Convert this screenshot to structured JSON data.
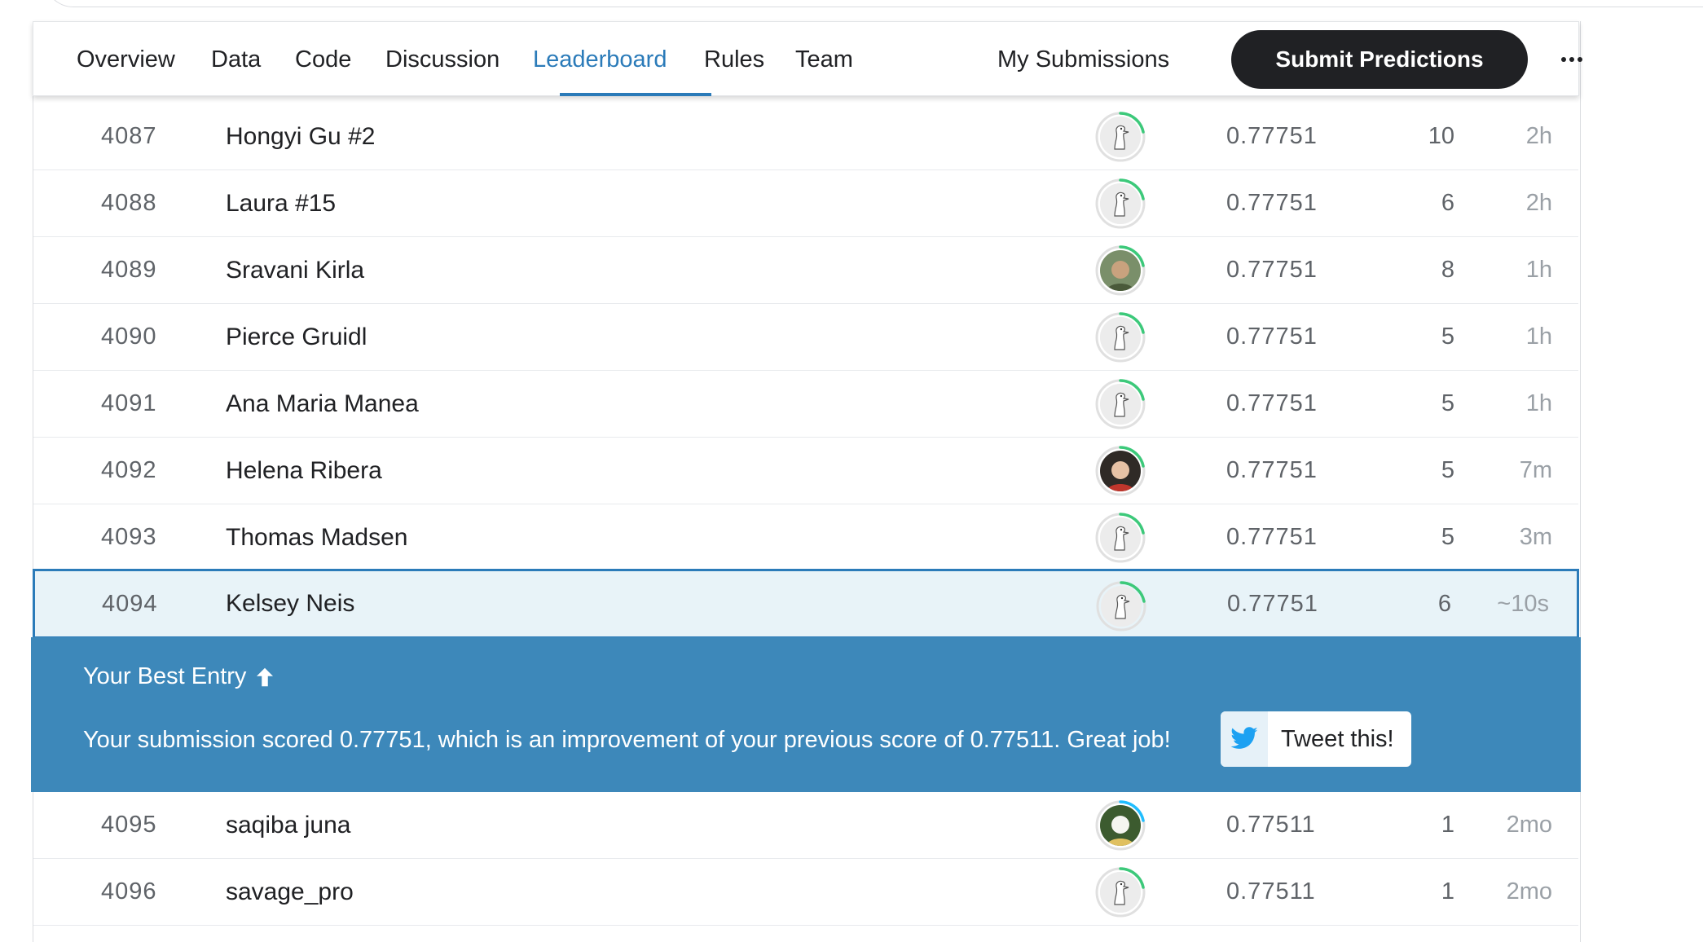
{
  "nav": {
    "tabs": [
      {
        "label": "Overview"
      },
      {
        "label": "Data"
      },
      {
        "label": "Code"
      },
      {
        "label": "Discussion"
      },
      {
        "label": "Leaderboard",
        "active": true
      },
      {
        "label": "Rules"
      },
      {
        "label": "Team"
      }
    ],
    "my_submissions": "My Submissions",
    "submit_label": "Submit Predictions",
    "more_icon": "more-horizontal-icon"
  },
  "rows_before": [
    {
      "rank": "4087",
      "name": "Hongyi Gu #2",
      "avatar": "default-avatar",
      "score": "0.77751",
      "entries": "10",
      "last": "2h"
    },
    {
      "rank": "4088",
      "name": "Laura #15",
      "avatar": "default-avatar",
      "score": "0.77751",
      "entries": "6",
      "last": "2h"
    },
    {
      "rank": "4089",
      "name": "Sravani Kirla",
      "avatar": "photo-avatar",
      "score": "0.77751",
      "entries": "8",
      "last": "1h"
    },
    {
      "rank": "4090",
      "name": "Pierce Gruidl",
      "avatar": "default-avatar",
      "score": "0.77751",
      "entries": "5",
      "last": "1h"
    },
    {
      "rank": "4091",
      "name": "Ana Maria Manea",
      "avatar": "default-avatar",
      "score": "0.77751",
      "entries": "5",
      "last": "1h"
    },
    {
      "rank": "4092",
      "name": "Helena Ribera",
      "avatar": "photo-avatar",
      "score": "0.77751",
      "entries": "5",
      "last": "7m"
    },
    {
      "rank": "4093",
      "name": "Thomas Madsen",
      "avatar": "default-avatar",
      "score": "0.77751",
      "entries": "5",
      "last": "3m"
    }
  ],
  "my_row": {
    "rank": "4094",
    "name": "Kelsey Neis",
    "avatar": "default-avatar",
    "score": "0.77751",
    "entries": "6",
    "last": "~10s"
  },
  "banner": {
    "title": "Your Best Entry",
    "arrow_icon": "arrow-up-icon",
    "message": "Your submission scored 0.77751, which is an improvement of your previous score of 0.77511. Great job!",
    "tweet_label": "Tweet this!",
    "tweet_icon": "twitter-bird-icon"
  },
  "rows_after": [
    {
      "rank": "4095",
      "name": "saqiba juna",
      "avatar": "photo-avatar",
      "score": "0.77511",
      "entries": "1",
      "last": "2mo"
    },
    {
      "rank": "4096",
      "name": "savage_pro",
      "avatar": "default-avatar",
      "score": "0.77511",
      "entries": "1",
      "last": "2mo"
    }
  ],
  "colors": {
    "accent": "#2b7bb9",
    "banner_bg": "#3d88ba",
    "highlight_row": "#e8f3f8",
    "tier_ring_green": "#20BEFF",
    "tier_ring": "#3cc97a"
  }
}
